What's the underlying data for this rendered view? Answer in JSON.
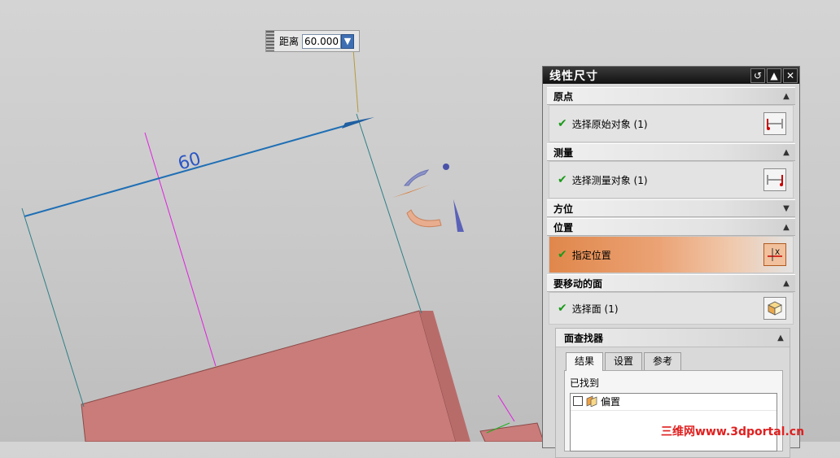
{
  "viewport": {
    "dimension_text": "60",
    "distance_label": "距离",
    "distance_value": "60.000",
    "face_color": "#c97c7a"
  },
  "dialog": {
    "title": "线性尺寸",
    "title_buttons": [
      "reset-icon",
      "collapse-icon",
      "close-icon"
    ],
    "sections": {
      "origin": {
        "label": "原点",
        "item": "选择原始对象 (1)"
      },
      "measure": {
        "label": "测量",
        "item": "选择测量对象 (1)"
      },
      "orientation": {
        "label": "方位"
      },
      "location": {
        "label": "位置",
        "item": "指定位置"
      },
      "faces": {
        "label": "要移动的面",
        "item": "选择面 (1)"
      }
    },
    "face_finder": {
      "label": "面查找器",
      "tabs": [
        "结果",
        "设置",
        "参考"
      ],
      "active_tab": "结果",
      "found_label": "已找到",
      "results": [
        {
          "label": "偏置",
          "checked": false
        }
      ]
    },
    "accent_color": "#e0874b"
  },
  "watermark": "三维网www.3dportal.cn"
}
